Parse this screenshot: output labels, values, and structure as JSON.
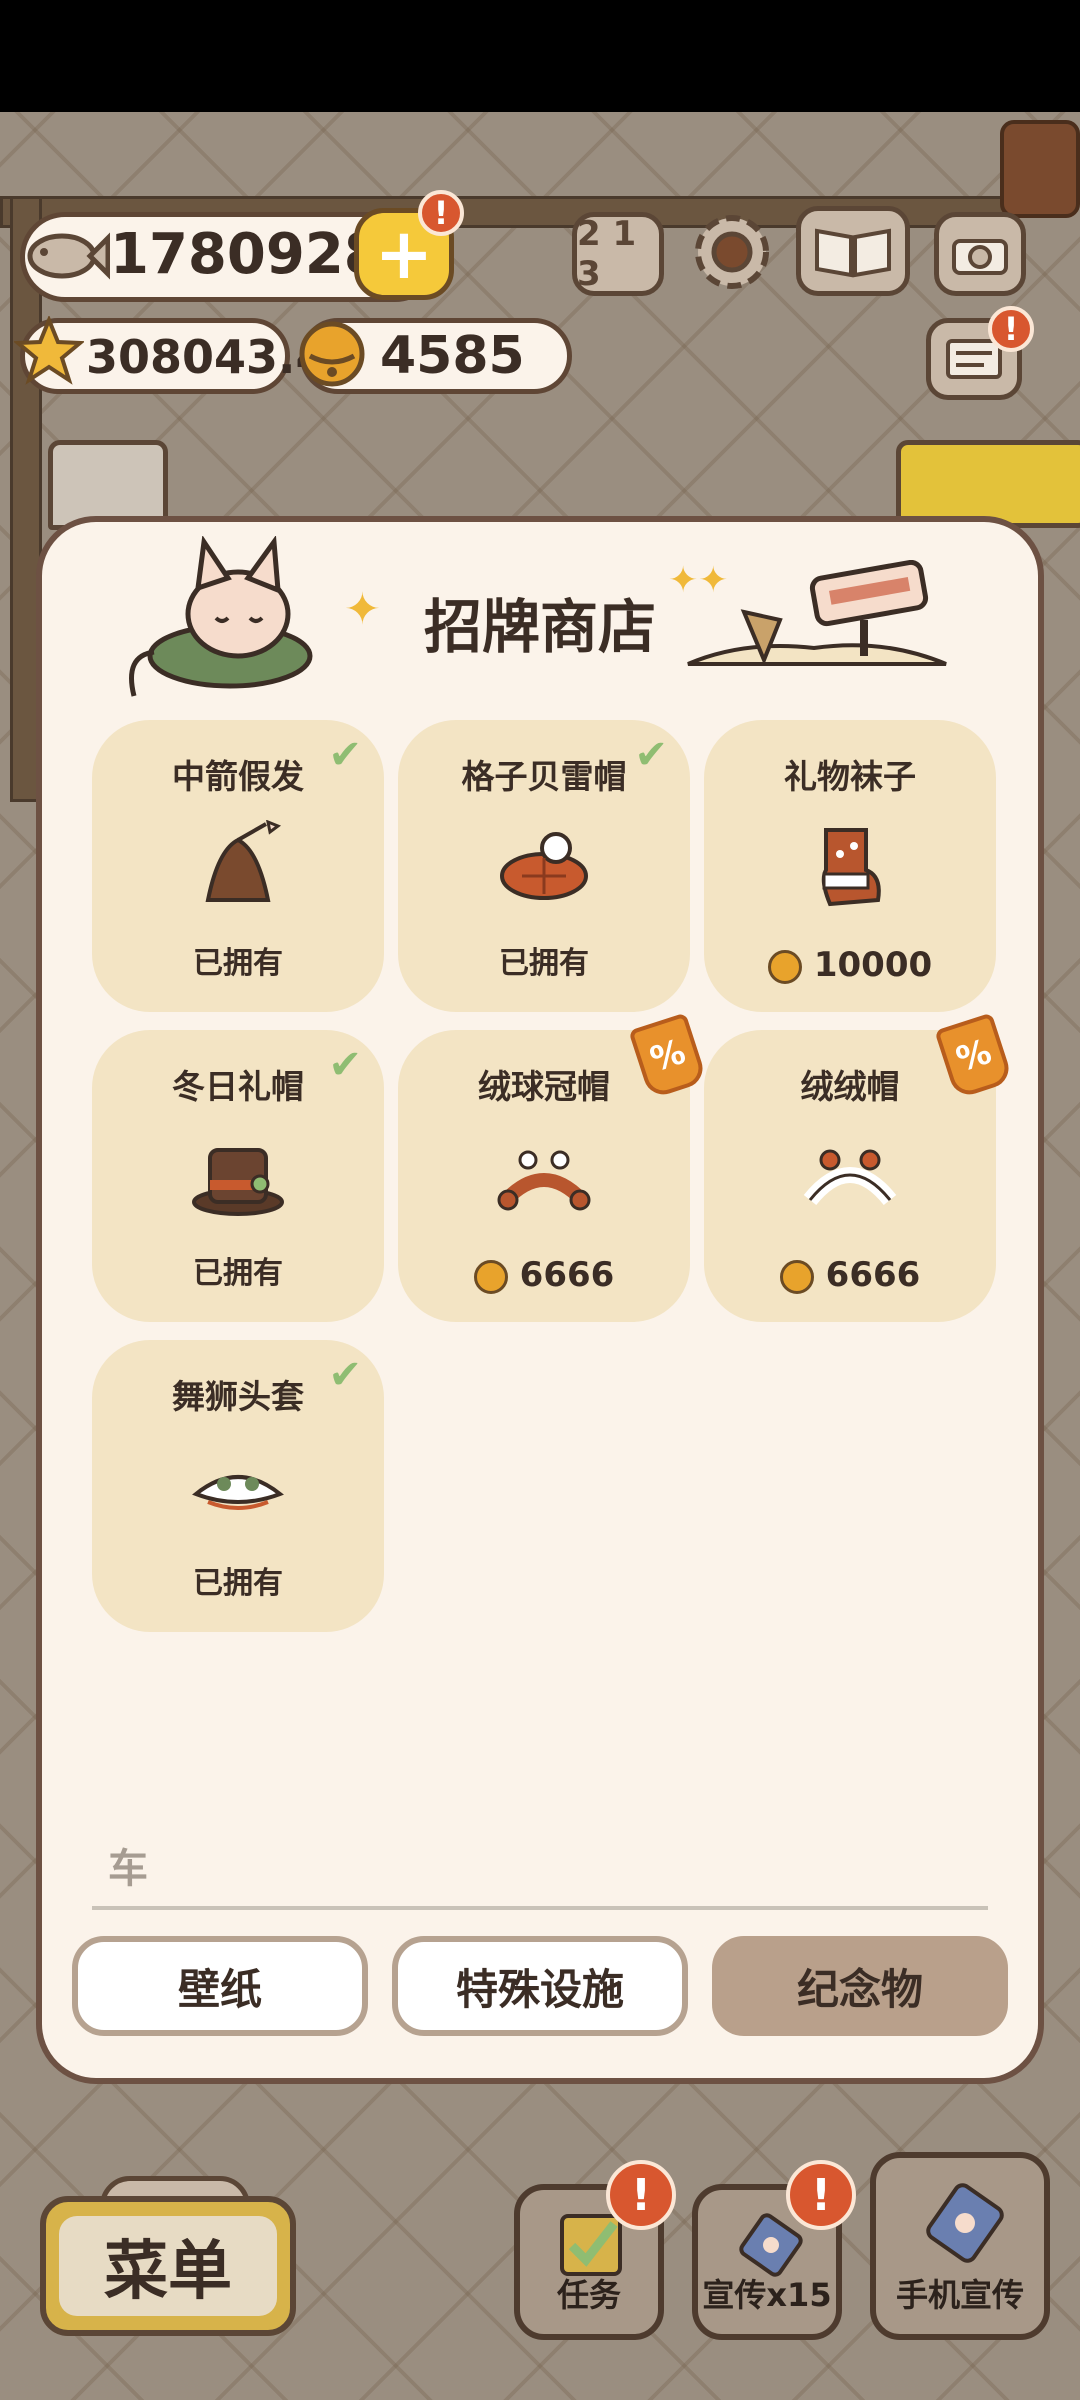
{
  "currency": {
    "fish": "17809285",
    "stars": "308043.4",
    "bells": "4585"
  },
  "top_icons": {
    "leaderboard": "2 1 3",
    "alert": "!"
  },
  "shop": {
    "title": "招牌商店",
    "items": [
      {
        "name": "中箭假发",
        "status": "已拥有",
        "owned": true
      },
      {
        "name": "格子贝雷帽",
        "status": "已拥有",
        "owned": true
      },
      {
        "name": "礼物袜子",
        "price": "10000",
        "owned": false
      },
      {
        "name": "冬日礼帽",
        "status": "已拥有",
        "owned": true
      },
      {
        "name": "绒球冠帽",
        "price": "6666",
        "owned": false,
        "discount": "%"
      },
      {
        "name": "绒绒帽",
        "price": "6666",
        "owned": false,
        "discount": "%"
      },
      {
        "name": "舞狮头套",
        "status": "已拥有",
        "owned": true
      }
    ],
    "search_placeholder": "车",
    "tabs": [
      {
        "label": "壁纸",
        "active": false
      },
      {
        "label": "特殊设施",
        "active": false
      },
      {
        "label": "纪念物",
        "active": true
      }
    ]
  },
  "bottom": {
    "menu_label": "菜单",
    "tasks_label": "任务",
    "promo_label": "宣传x15",
    "phone_promo_label": "手机宣传"
  },
  "colors": {
    "panel": "#fbf3ea",
    "card": "#f3e4c4",
    "check": "#8fbd72",
    "discount": "#e8912c",
    "badge": "#d8572f"
  }
}
